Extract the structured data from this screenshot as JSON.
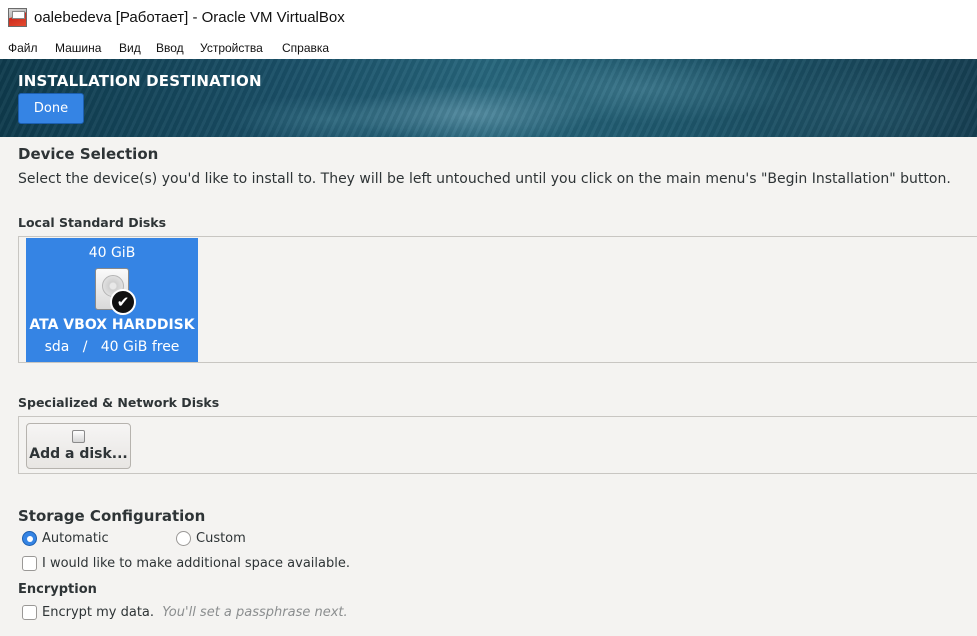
{
  "window": {
    "title": "oalebedeva [Работает] - Oracle VM VirtualBox",
    "menu": [
      "Файл",
      "Машина",
      "Вид",
      "Ввод",
      "Устройства",
      "Справка"
    ]
  },
  "header": {
    "title": "INSTALLATION DESTINATION",
    "done_label": "Done"
  },
  "device_selection": {
    "title": "Device Selection",
    "description": "Select the device(s) you'd like to install to.  They will be left untouched until you click on the main menu's \"Begin Installation\" button."
  },
  "local_disks": {
    "label": "Local Standard Disks",
    "disks": [
      {
        "size": "40 GiB",
        "name": "ATA VBOX HARDDISK",
        "free": "sda   /   40 GiB free",
        "selected": true,
        "icon": "harddisk-icon"
      }
    ]
  },
  "network_disks": {
    "label": "Specialized & Network Disks",
    "add_label": "Add a disk..."
  },
  "storage": {
    "title": "Storage Configuration",
    "automatic_label": "Automatic",
    "custom_label": "Custom",
    "selected": "Automatic",
    "additional_space_label": "I would like to make additional space available."
  },
  "encryption": {
    "title": "Encryption",
    "encrypt_label": "Encrypt my data.",
    "hint": "You'll set a passphrase next."
  },
  "colors": {
    "accent": "#3584e4",
    "background": "#f4f3f1"
  }
}
